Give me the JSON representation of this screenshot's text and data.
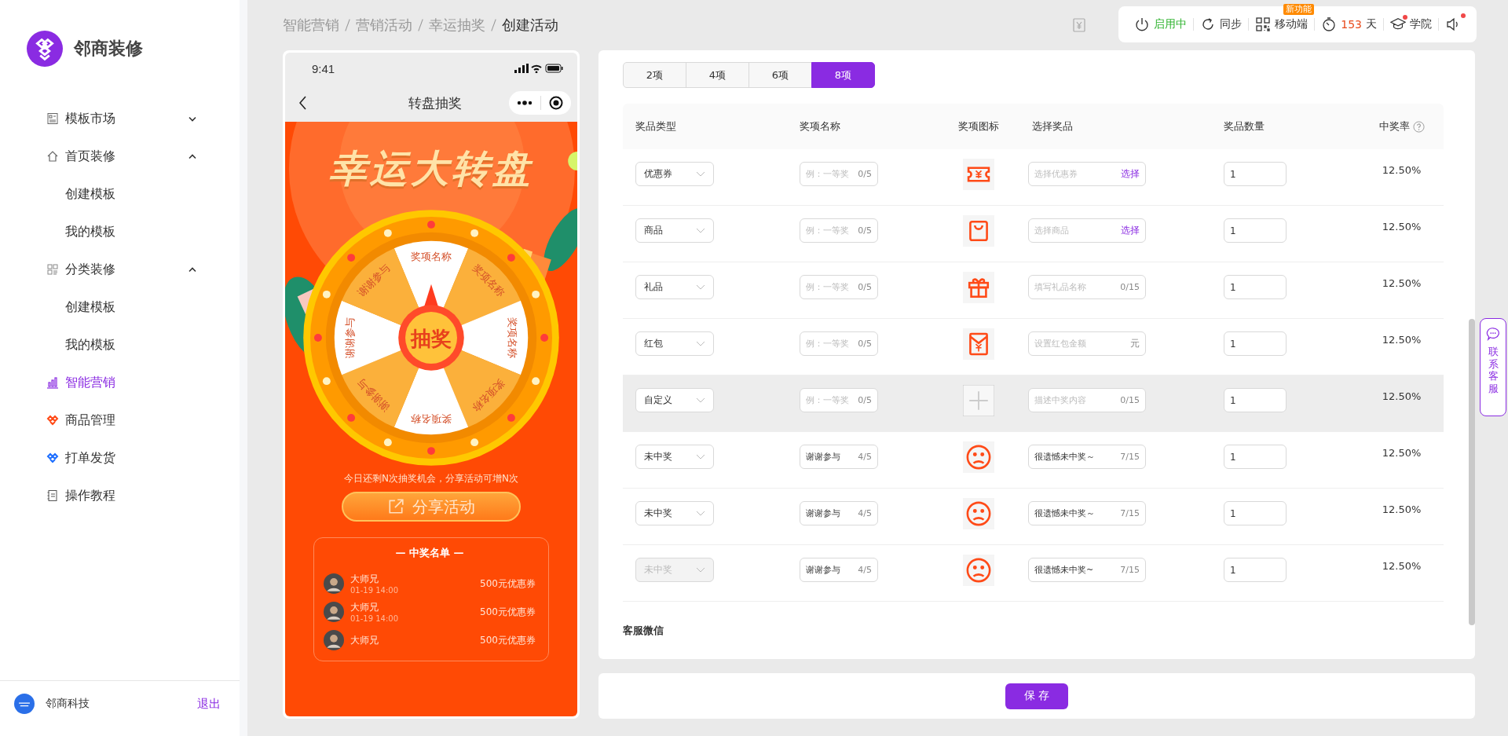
{
  "sidebar": {
    "brand": "邻商装修",
    "items": [
      {
        "label": "模板市场",
        "kind": "template",
        "expanded": false,
        "selected": false
      },
      {
        "label": "首页装修",
        "kind": "home",
        "expanded": true,
        "selected": false,
        "children": [
          {
            "label": "创建模板",
            "selected": false
          },
          {
            "label": "我的模板",
            "selected": false
          }
        ]
      },
      {
        "label": "分类装修",
        "kind": "category",
        "expanded": true,
        "selected": false,
        "children": [
          {
            "label": "创建模板",
            "selected": false
          },
          {
            "label": "我的模板",
            "selected": false
          }
        ]
      },
      {
        "label": "智能营销",
        "kind": "chart",
        "selected": true
      },
      {
        "label": "商品管理",
        "kind": "goods",
        "selected": false
      },
      {
        "label": "打单发货",
        "kind": "shipping",
        "selected": false
      },
      {
        "label": "操作教程",
        "kind": "book",
        "selected": false
      }
    ],
    "user": {
      "name": "邻商科技",
      "logout": "退出"
    }
  },
  "breadcrumb": [
    "智能营销",
    "营销活动",
    "幸运抽奖",
    "创建活动"
  ],
  "toolbar": {
    "status": "启用中",
    "sync": "同步",
    "mobile": "移动端",
    "mobile_badge": "新功能",
    "days": "153",
    "days_unit": "天",
    "academy": "学院",
    "academy_dot": true,
    "sound_dot": true
  },
  "phone": {
    "time": "9:41",
    "title": "转盘抽奖",
    "banner": "幸运大转盘",
    "segments": [
      "奖项名称",
      "奖项名称",
      "奖项名称",
      "奖项名称",
      "奖项名称",
      "谢谢参与",
      "谢谢参与",
      "谢谢参与"
    ],
    "center": "抽奖",
    "hint": "今日还剩N次抽奖机会，分享活动可增N次",
    "share": "分享活动",
    "winners_title": "— 中奖名单 —",
    "winners": [
      {
        "name": "大师兄",
        "time": "01-19 14:00",
        "prize": "500元优惠券"
      },
      {
        "name": "大师兄",
        "time": "01-19 14:00",
        "prize": "500元优惠券"
      },
      {
        "name": "大师兄",
        "prize": "500元优惠券"
      }
    ]
  },
  "tabs": [
    {
      "label": "2项",
      "selected": false
    },
    {
      "label": "4项",
      "selected": false
    },
    {
      "label": "6项",
      "selected": false
    },
    {
      "label": "8项",
      "selected": true
    }
  ],
  "table": {
    "columns": [
      "奖品类型",
      "奖项名称",
      "奖项图标",
      "选择奖品",
      "奖品数量",
      "中奖率"
    ],
    "rows": [
      {
        "type": "优惠券",
        "type_disabled": false,
        "name": {
          "placeholder": "例：一等奖",
          "count": "0/5"
        },
        "kind": "coupon",
        "prize": {
          "placeholder": "选择优惠券",
          "suffix": "选择",
          "kind": "link"
        },
        "quantity": "1",
        "rate": "12.50%",
        "highlighted": false
      },
      {
        "type": "商品",
        "type_disabled": false,
        "name": {
          "placeholder": "例：一等奖",
          "count": "0/5"
        },
        "kind": "bag",
        "prize": {
          "placeholder": "选择商品",
          "suffix": "选择",
          "kind": "link"
        },
        "quantity": "1",
        "rate": "12.50%",
        "highlighted": false
      },
      {
        "type": "礼品",
        "type_disabled": false,
        "name": {
          "placeholder": "例：一等奖",
          "count": "0/5"
        },
        "kind": "gift",
        "prize": {
          "placeholder": "填写礼品名称",
          "suffix": "0/15",
          "kind": "count"
        },
        "quantity": "1",
        "rate": "12.50%",
        "highlighted": false
      },
      {
        "type": "红包",
        "type_disabled": false,
        "name": {
          "placeholder": "例：一等奖",
          "count": "0/5"
        },
        "kind": "redpacket",
        "prize": {
          "placeholder": "设置红包金额",
          "suffix": "元",
          "kind": "unit"
        },
        "quantity": "1",
        "rate": "12.50%",
        "highlighted": false
      },
      {
        "type": "自定义",
        "type_disabled": false,
        "name": {
          "placeholder": "例：一等奖",
          "count": "0/5"
        },
        "kind": "add",
        "prize": {
          "placeholder": "描述中奖内容",
          "suffix": "0/15",
          "kind": "count"
        },
        "quantity": "1",
        "rate": "12.50%",
        "highlighted": true
      },
      {
        "type": "未中奖",
        "type_disabled": false,
        "name": {
          "value": "谢谢参与",
          "count": "4/5"
        },
        "kind": "sad",
        "prize": {
          "value": "很遗憾未中奖～",
          "suffix": "7/15",
          "kind": "count"
        },
        "quantity": "1",
        "rate": "12.50%",
        "highlighted": false
      },
      {
        "type": "未中奖",
        "type_disabled": false,
        "name": {
          "value": "谢谢参与",
          "count": "4/5"
        },
        "kind": "sad",
        "prize": {
          "value": "很遗憾未中奖～",
          "suffix": "7/15",
          "kind": "count"
        },
        "quantity": "1",
        "rate": "12.50%",
        "highlighted": false
      },
      {
        "type": "未中奖",
        "type_disabled": true,
        "name": {
          "value": "谢谢参与",
          "count": "4/5"
        },
        "kind": "sad",
        "prize": {
          "value": "很遗憾未中奖~",
          "suffix": "7/15",
          "kind": "count"
        },
        "quantity": "1",
        "rate": "12.50%",
        "highlighted": false
      }
    ]
  },
  "section_title": "客服微信",
  "save": "保 存",
  "contact": "联系客服"
}
